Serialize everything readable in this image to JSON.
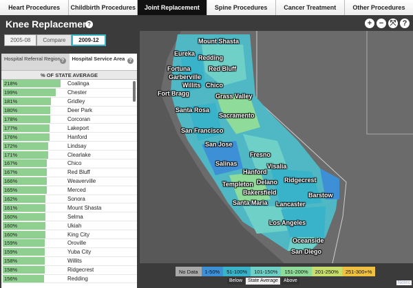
{
  "nav": {
    "tabs": [
      {
        "label": "Heart Procedures",
        "active": false
      },
      {
        "label": "Childbirth Procedures",
        "active": false
      },
      {
        "label": "Joint Replacement",
        "active": true
      },
      {
        "label": "Spine Procedures",
        "active": false
      },
      {
        "label": "Cancer Treatment",
        "active": false
      },
      {
        "label": "Other Procedures",
        "active": false
      }
    ]
  },
  "title": "Knee Replacement",
  "help_glyph": "?",
  "map_controls": [
    "+",
    "−",
    "⤧",
    "?"
  ],
  "period": {
    "left": "2005-08",
    "compare": "Compare",
    "right": "2009-12",
    "selected": "2009-12"
  },
  "panel": {
    "tab_referral": "Hospital Referral Region",
    "tab_service": "Hospital Service Area",
    "column_header": "% OF STATE AVERAGE",
    "rows": [
      {
        "value": "218%",
        "pct": 218,
        "name": "Coalinga"
      },
      {
        "value": "199%",
        "pct": 199,
        "name": "Chester"
      },
      {
        "value": "181%",
        "pct": 181,
        "name": "Gridley"
      },
      {
        "value": "180%",
        "pct": 180,
        "name": "Deer Park"
      },
      {
        "value": "178%",
        "pct": 178,
        "name": "Corcoran"
      },
      {
        "value": "177%",
        "pct": 177,
        "name": "Lakeport"
      },
      {
        "value": "176%",
        "pct": 176,
        "name": "Hanford"
      },
      {
        "value": "172%",
        "pct": 172,
        "name": "Lindsay"
      },
      {
        "value": "171%",
        "pct": 171,
        "name": "Clearlake"
      },
      {
        "value": "167%",
        "pct": 167,
        "name": "Chico"
      },
      {
        "value": "167%",
        "pct": 167,
        "name": "Red Bluff"
      },
      {
        "value": "166%",
        "pct": 166,
        "name": "Weaverville"
      },
      {
        "value": "165%",
        "pct": 165,
        "name": "Merced"
      },
      {
        "value": "162%",
        "pct": 162,
        "name": "Sonora"
      },
      {
        "value": "161%",
        "pct": 161,
        "name": "Mount Shasta"
      },
      {
        "value": "160%",
        "pct": 160,
        "name": "Selma"
      },
      {
        "value": "160%",
        "pct": 160,
        "name": "Ukiah"
      },
      {
        "value": "160%",
        "pct": 160,
        "name": "King City"
      },
      {
        "value": "159%",
        "pct": 159,
        "name": "Oroville"
      },
      {
        "value": "159%",
        "pct": 159,
        "name": "Yuba City"
      },
      {
        "value": "158%",
        "pct": 158,
        "name": "Willits"
      },
      {
        "value": "158%",
        "pct": 158,
        "name": "Ridgecrest"
      },
      {
        "value": "156%",
        "pct": 156,
        "name": "Redding"
      }
    ]
  },
  "map": {
    "labels": [
      "Mount Shasta",
      "Eureka",
      "Redding",
      "Fortuna",
      "Red Bluff",
      "Garberville",
      "Willits",
      "Chico",
      "Fort Bragg",
      "Grass Valley",
      "Santa Rosa",
      "Sacramento",
      "San Francisco",
      "San Jose",
      "Fresno",
      "Salinas",
      "Hanford",
      "Visalia",
      "Templeton",
      "Delano",
      "Ridgecrest",
      "Bakersfield",
      "Santa Maria",
      "Lancaster",
      "Barstow",
      "Los Angeles",
      "Oceanside",
      "San Diego"
    ]
  },
  "legend": {
    "items": [
      {
        "label": "No Data",
        "color": "#a9a9a9"
      },
      {
        "label": "1-50%",
        "color": "#3d8fd6"
      },
      {
        "label": "51-100%",
        "color": "#38b3c9"
      },
      {
        "label": "101-150%",
        "color": "#6fd0c8"
      },
      {
        "label": "151-200%",
        "color": "#8fdc9a"
      },
      {
        "label": "201-250%",
        "color": "#c7dd6e"
      },
      {
        "label": "251-300+%",
        "color": "#f0c040"
      }
    ],
    "below": "Below",
    "state_average": "State Average",
    "above": "Above",
    "notes": "Notes"
  }
}
